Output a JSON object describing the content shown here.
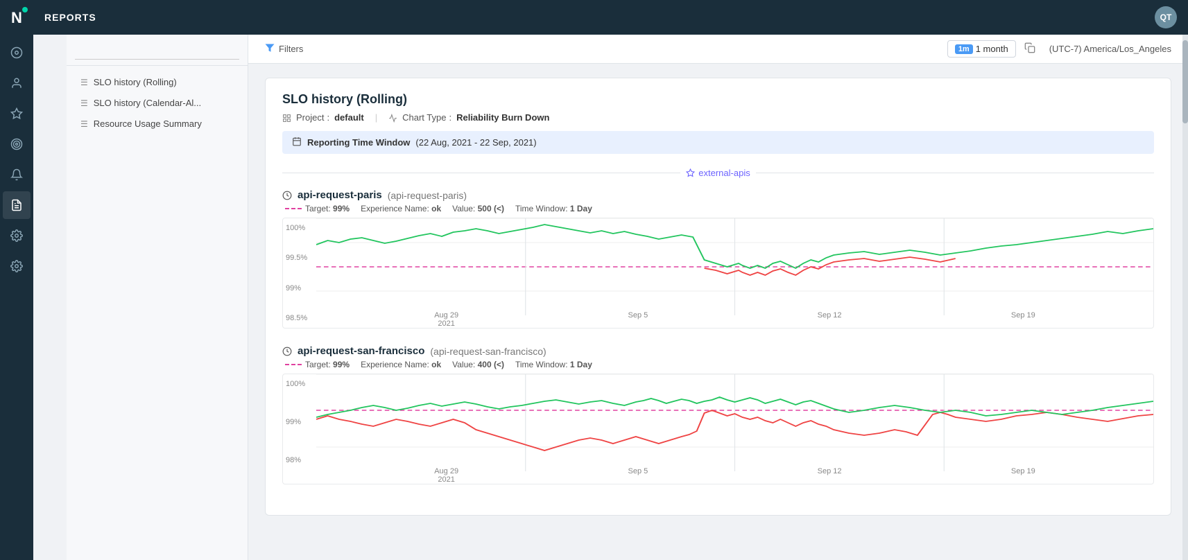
{
  "app": {
    "title": "REPORTS"
  },
  "user": {
    "initials": "QT"
  },
  "nav": {
    "items": [
      {
        "id": "overview",
        "icon": "⊙",
        "label": "overview-icon"
      },
      {
        "id": "users",
        "icon": "👤",
        "label": "users-icon"
      },
      {
        "id": "integrations",
        "icon": "✳",
        "label": "integrations-icon"
      },
      {
        "id": "target",
        "icon": "◎",
        "label": "target-icon"
      },
      {
        "id": "alerts",
        "icon": "🔔",
        "label": "alerts-icon"
      },
      {
        "id": "reports",
        "icon": "📋",
        "label": "reports-icon",
        "active": true
      },
      {
        "id": "settings1",
        "icon": "⚙",
        "label": "settings1-icon"
      },
      {
        "id": "settings2",
        "icon": "⚙",
        "label": "settings2-icon"
      }
    ]
  },
  "sidebar": {
    "search": {
      "placeholder": ""
    },
    "items": [
      {
        "id": "slo-rolling",
        "label": "SLO history (Rolling)",
        "icon": "☰"
      },
      {
        "id": "slo-calendar",
        "label": "SLO history (Calendar-Al...",
        "icon": "☰"
      },
      {
        "id": "resource-usage",
        "label": "Resource Usage Summary",
        "icon": "☰"
      }
    ]
  },
  "toolbar": {
    "filter_label": "Filters",
    "time_badge": "1m",
    "time_label": "1 month",
    "timezone": "(UTC-7) America/Los_Angeles"
  },
  "report": {
    "title": "SLO history (Rolling)",
    "project_label": "Project",
    "project_value": "default",
    "chart_type_label": "Chart Type",
    "chart_type_value": "Reliability Burn Down",
    "time_window_label": "Reporting Time Window",
    "time_window_value": "(22 Aug, 2021 - 22 Sep, 2021)",
    "section_label": "external-apis",
    "slos": [
      {
        "id": "paris",
        "name": "api-request-paris",
        "sub": "(api-request-paris)",
        "target": "99%",
        "experience_name": "ok",
        "value": "500 (<)",
        "time_window": "1 Day",
        "y_labels": [
          "100%",
          "99.5%",
          "99%",
          "98.5%"
        ],
        "x_labels": [
          "Aug 29\n2021",
          "Sep 5",
          "Sep 12",
          "Sep 19"
        ]
      },
      {
        "id": "san-francisco",
        "name": "api-request-san-francisco",
        "sub": "(api-request-san-francisco)",
        "target": "99%",
        "experience_name": "ok",
        "value": "400 (<)",
        "time_window": "1 Day",
        "y_labels": [
          "100%",
          "99%",
          "98%"
        ],
        "x_labels": [
          "Aug 29\n2021",
          "Sep 5",
          "Sep 12",
          "Sep 19"
        ]
      }
    ]
  }
}
